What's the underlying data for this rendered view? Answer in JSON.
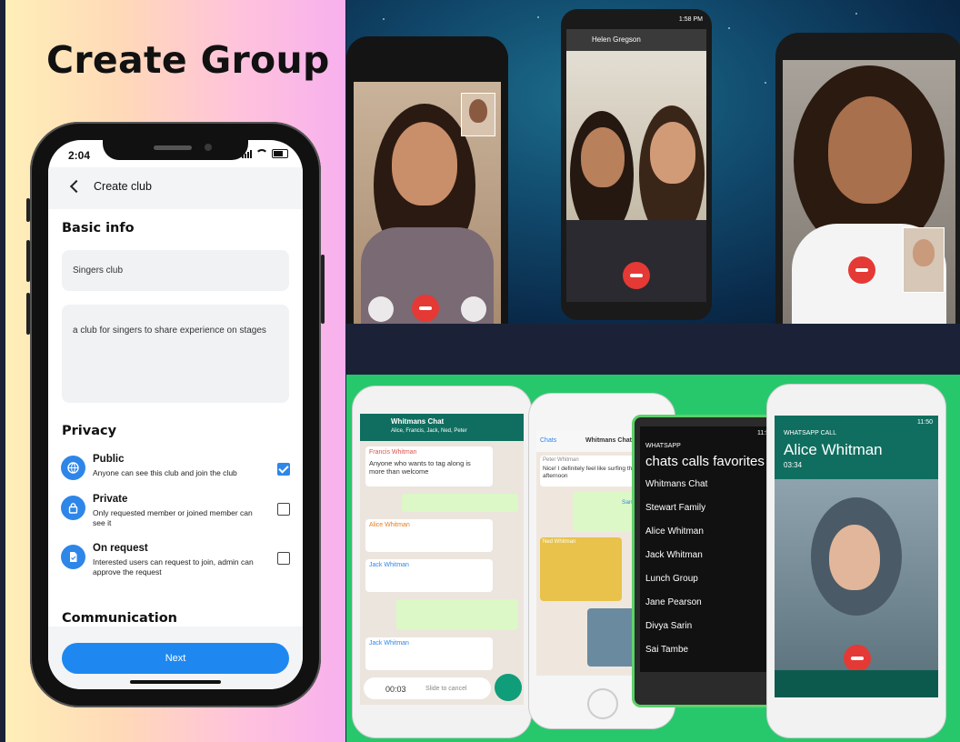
{
  "heading": "Create Group",
  "phone": {
    "status_time": "2:04",
    "header_title": "Create club",
    "basic_info_title": "Basic info",
    "club_name_value": "Singers club",
    "club_desc_value": "a club for singers to share experience on stages",
    "privacy_title": "Privacy",
    "options": [
      {
        "title": "Public",
        "desc": "Anyone can see this club and join the club",
        "checked": true
      },
      {
        "title": "Private",
        "desc": "Only requested member or joined member can see it",
        "checked": false
      },
      {
        "title": "On request",
        "desc": "Interested users can request to join, admin can approve the request",
        "checked": false
      }
    ],
    "communication_title": "Communication",
    "next_label": "Next"
  },
  "top_image": {
    "middle_status_time": "1:58 PM",
    "middle_contact": "Helen Gregson"
  },
  "bottom_image": {
    "chat_name": "Whitmans Chat",
    "chat_members": "Alice, Francis, Jack, Ned, Peter",
    "chat_time": "11:50",
    "sender_francis": "Francis Whitman",
    "msg_francis": "Anyone who wants to tag along is more than welcome",
    "sender_alice": "Alice Whitman",
    "sender_jack": "Jack Whitman",
    "voice_time": "00:03",
    "slide_cancel": "Slide to cancel",
    "chat2_back": "Chats",
    "chat2_title": "Whitmans Chat",
    "sender_peter": "Peter Whitman",
    "msg_peter": "Nice! I definitely feel like surfing this afternoon",
    "location": "Santa Cruz",
    "sender_ned": "Ned Whitman",
    "wp_time": "11:50",
    "wp_app": "WHATSAPP",
    "wp_tabs": "chats calls favorites",
    "wp_list": [
      "Whitmans Chat",
      "Stewart Family",
      "Alice Whitman",
      "Jack Whitman",
      "Lunch Group",
      "Jane Pearson",
      "Divya Sarin",
      "Sai Tambe"
    ],
    "call_label": "WHATSAPP CALL",
    "call_name": "Alice Whitman",
    "call_duration": "03:34",
    "call_time": "11:50"
  },
  "colors": {
    "accent": "#1e88f0",
    "whatsapp_green": "#27c86c",
    "end_call": "#e53935"
  }
}
